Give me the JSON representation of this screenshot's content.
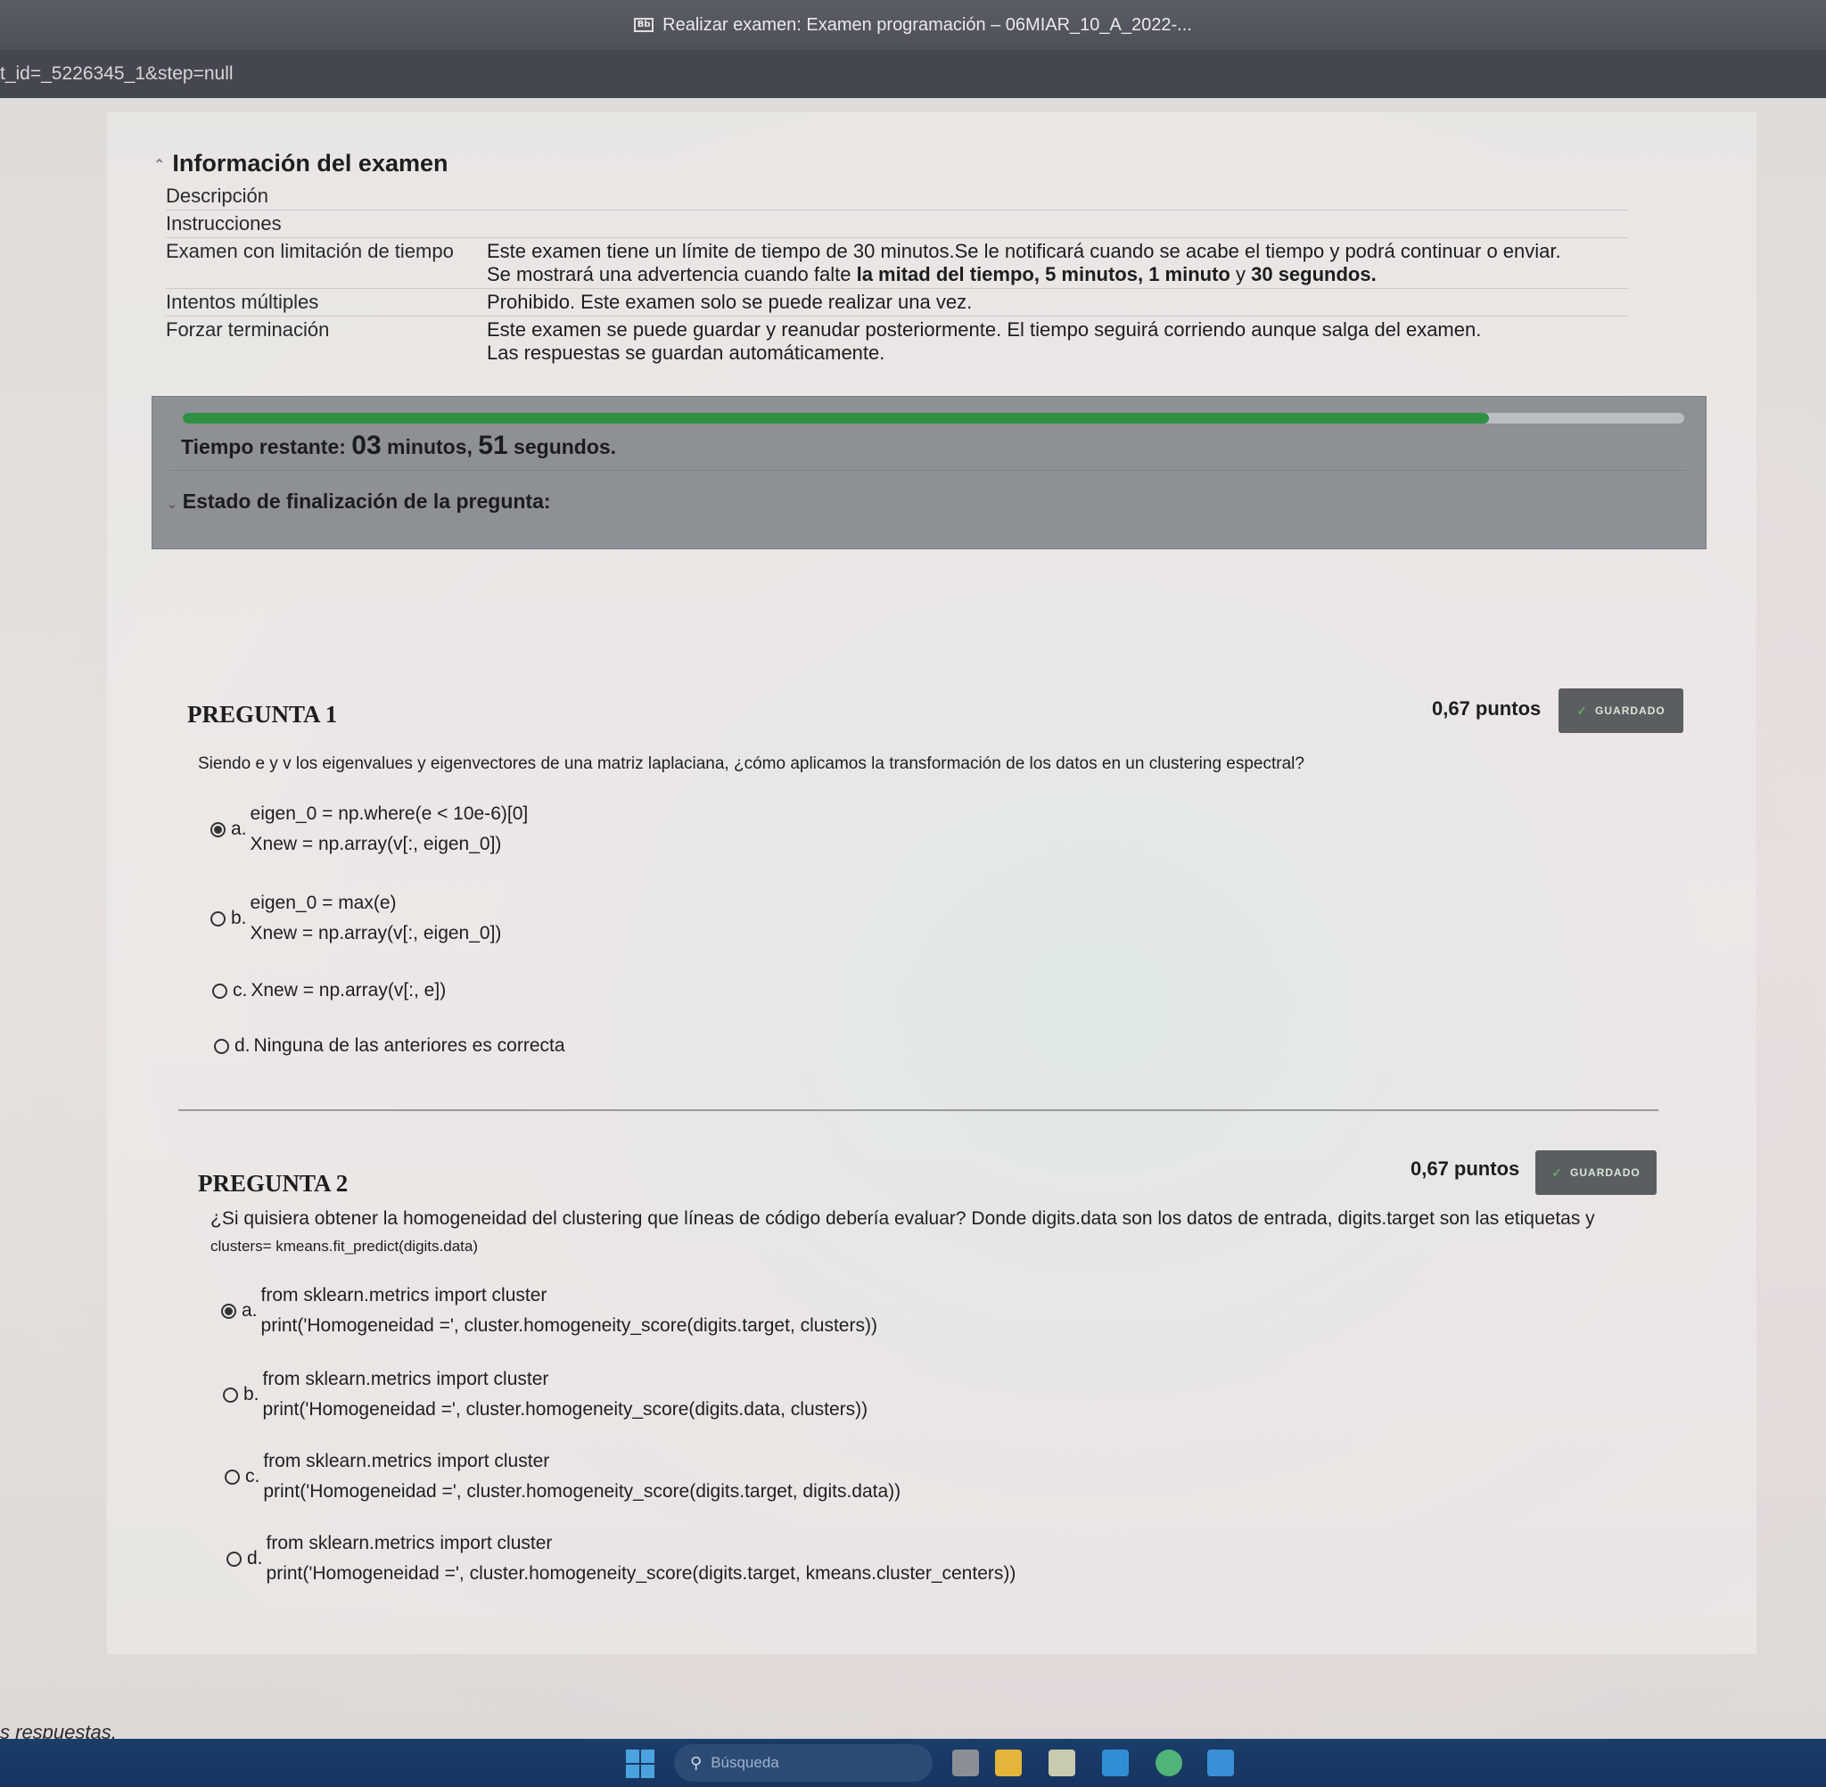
{
  "window": {
    "favicon_text": "Bb",
    "title": "Realizar examen: Examen programación – 06MIAR_10_A_2022-...",
    "url_fragment": "t_id=_5226345_1&step=null"
  },
  "exam_info": {
    "title": "Información del examen",
    "rows": [
      {
        "key": "Descripción",
        "value": ""
      },
      {
        "key": "Instrucciones",
        "value": ""
      },
      {
        "key": "Examen con limitación de tiempo",
        "value": "Este examen tiene un límite de tiempo de 30 minutos.Se le notificará cuando se acabe el tiempo y podrá continuar o enviar.",
        "value2_prefix": "Se mostrará una advertencia cuando falte ",
        "value2_bold": "la mitad del tiempo, 5 minutos, 1 minuto",
        "value2_mid": " y ",
        "value2_bold2": "30 segundos."
      },
      {
        "key": "Intentos múltiples",
        "value": "Prohibido. Este examen solo se puede realizar una vez."
      },
      {
        "key": "Forzar terminación",
        "value": "Este examen se puede guardar y reanudar posteriormente. El tiempo seguirá corriendo aunque salga del examen.",
        "value2": "Las respuestas se guardan automáticamente."
      }
    ]
  },
  "timer": {
    "progress_fraction": 0.87,
    "label": "Tiempo restante: ",
    "minutes": "03",
    "minutes_word": " minutos, ",
    "seconds": "51",
    "seconds_word": " segundos.",
    "status_label": "Estado de finalización de la pregunta:"
  },
  "questions": [
    {
      "title": "PREGUNTA 1",
      "points": "0,67 puntos",
      "saved": "GUARDADO",
      "text": "Siendo e y v los eigenvalues y eigenvectores de una matriz laplaciana, ¿cómo aplicamos la transformación de los datos en un clustering espectral?",
      "options": [
        {
          "letter": "a.",
          "lines": [
            "eigen_0 = np.where(e < 10e-6)[0]",
            "Xnew = np.array(v[:, eigen_0])"
          ],
          "selected": true
        },
        {
          "letter": "b.",
          "lines": [
            "eigen_0 = max(e)",
            "Xnew = np.array(v[:, eigen_0])"
          ],
          "selected": false
        },
        {
          "letter": "c.",
          "lines": [
            "Xnew = np.array(v[:, e])"
          ],
          "selected": false
        },
        {
          "letter": "d.",
          "lines": [
            "Ninguna de las anteriores es correcta"
          ],
          "selected": false
        }
      ]
    },
    {
      "title": "PREGUNTA 2",
      "points": "0,67 puntos",
      "saved": "GUARDADO",
      "text": "¿Si quisiera obtener la homogeneidad del clustering que líneas de código debería evaluar? Donde digits.data son los datos de entrada, digits.target son las etiquetas y ",
      "text_small": "clusters= kmeans.fit_predict(digits.data)",
      "options": [
        {
          "letter": "a.",
          "lines": [
            "from sklearn.metrics import cluster",
            "print('Homogeneidad =', cluster.homogeneity_score(digits.target, clusters))"
          ],
          "selected": true
        },
        {
          "letter": "b.",
          "lines": [
            "from sklearn.metrics import cluster",
            "print('Homogeneidad =', cluster.homogeneity_score(digits.data, clusters))"
          ],
          "selected": false
        },
        {
          "letter": "c.",
          "lines": [
            "from sklearn.metrics import cluster",
            "print('Homogeneidad =', cluster.homogeneity_score(digits.target, digits.data))"
          ],
          "selected": false
        },
        {
          "letter": "d.",
          "lines": [
            "from sklearn.metrics import cluster",
            "print('Homogeneidad =', cluster.homogeneity_score(digits.target, kmeans.cluster_centers))"
          ],
          "selected": false
        }
      ]
    }
  ],
  "footer": {
    "text": "s respuestas."
  },
  "taskbar": {
    "search_placeholder": "Búsqueda"
  }
}
